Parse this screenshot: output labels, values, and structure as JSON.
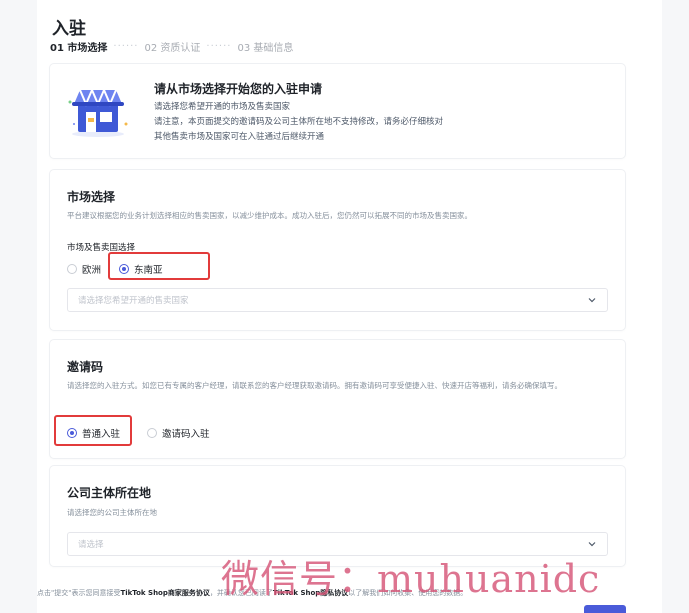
{
  "page": {
    "title": "入驻"
  },
  "steps": [
    {
      "label": "01 市场选择",
      "active": true
    },
    {
      "label": "02 资质认证",
      "active": false
    },
    {
      "label": "03 基础信息",
      "active": false
    }
  ],
  "step_separator": "······",
  "intro": {
    "title": "请从市场选择开始您的入驻申请",
    "lines": [
      "请选择您希望开通的市场及售卖国家",
      "请注意，本页面提交的邀请码及公司主体所在地不支持修改，请务必仔细核对",
      "其他售卖市场及国家可在入驻通过后继续开通"
    ]
  },
  "market": {
    "title": "市场选择",
    "desc": "平台建议根据您的业务计划选择相应的售卖国家，以减少维护成本。成功入驻后，您仍然可以拓展不同的市场及售卖国家。",
    "field_label": "市场及售卖国选择",
    "options": [
      {
        "label": "欧洲",
        "checked": false
      },
      {
        "label": "东南亚",
        "checked": true
      }
    ],
    "select_placeholder": "请选择您希望开通的售卖国家"
  },
  "invite": {
    "title": "邀请码",
    "desc": "请选择您的入驻方式。如您已有专属的客户经理，请联系您的客户经理获取邀请码。拥有邀请码可享受便捷入驻、快速开店等福利，请务必确保填写。",
    "options": [
      {
        "label": "普通入驻",
        "checked": true
      },
      {
        "label": "邀请码入驻",
        "checked": false
      }
    ]
  },
  "company": {
    "title": "公司主体所在地",
    "desc": "请选择您的公司主体所在地",
    "select_placeholder": "请选择"
  },
  "footer": {
    "prefix": "点击\"提交\"表示您同意接受",
    "link1": "TikTok Shop商家服务协议",
    "middle": "，并确认您已阅读了",
    "link2": "TikTok Shop隐私协议",
    "suffix": "以了解我们如何收集、使用您的数据。"
  },
  "watermark": "微信号：muhuanidc",
  "colors": {
    "accent": "#4a5bd9",
    "highlight": "#e23b3b"
  }
}
